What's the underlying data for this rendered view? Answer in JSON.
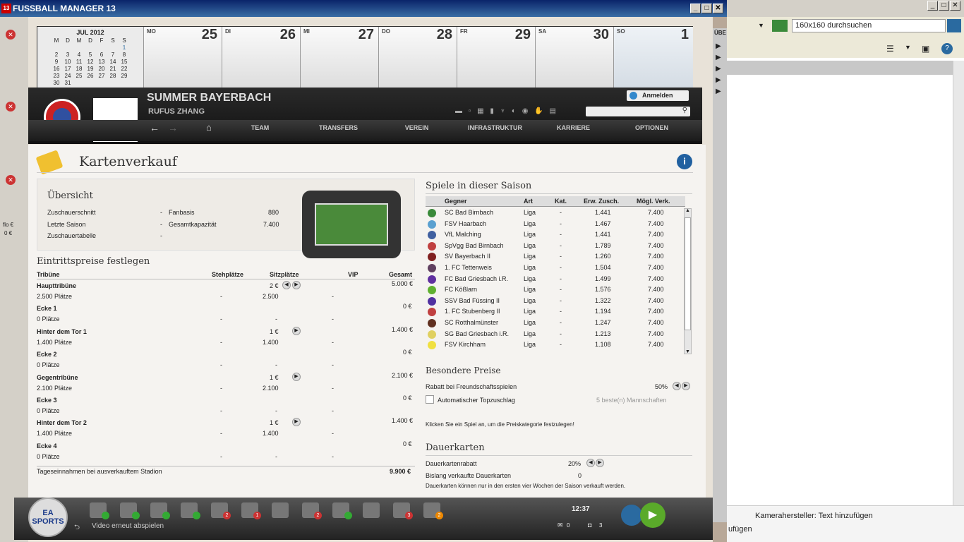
{
  "window": {
    "title": "FUSSBALL MANAGER 13",
    "logo": "13"
  },
  "calendar": {
    "month": "JUL 2012",
    "weekdays": [
      "M",
      "D",
      "M",
      "D",
      "F",
      "S",
      "S"
    ],
    "weeks": [
      [
        "",
        "",
        "",
        "",
        "",
        "",
        "1"
      ],
      [
        "2",
        "3",
        "4",
        "5",
        "6",
        "7",
        "8"
      ],
      [
        "9",
        "10",
        "11",
        "12",
        "13",
        "14",
        "15"
      ],
      [
        "16",
        "17",
        "18",
        "19",
        "20",
        "21",
        "22"
      ],
      [
        "23",
        "24",
        "25",
        "26",
        "27",
        "28",
        "29"
      ],
      [
        "30",
        "31",
        "",
        "",
        "",
        "",
        ""
      ]
    ],
    "days": [
      {
        "name": "MO",
        "num": "25"
      },
      {
        "name": "DI",
        "num": "26"
      },
      {
        "name": "MI",
        "num": "27"
      },
      {
        "name": "DO",
        "num": "28"
      },
      {
        "name": "FR",
        "num": "29"
      },
      {
        "name": "SA",
        "num": "30"
      },
      {
        "name": "SO",
        "num": "1"
      }
    ]
  },
  "club": {
    "name": "SUMMER BAYERBACH",
    "manager": "RUFUS ZHANG",
    "login_label": "Anmelden"
  },
  "nav": [
    "TEAM",
    "TRANSFERS",
    "VEREIN",
    "INFRASTRUKTUR",
    "KARRIERE",
    "OPTIONEN"
  ],
  "page": {
    "title": "Kartenverkauf"
  },
  "overview": {
    "title": "Übersicht",
    "left": [
      {
        "label": "Zuschauerschnitt",
        "value": "-"
      },
      {
        "label": "Letzte Saison",
        "value": "-"
      },
      {
        "label": "Zuschauertabelle",
        "value": "-"
      }
    ],
    "right": [
      {
        "label": "Fanbasis",
        "value": "880"
      },
      {
        "label": "Gesamtkapazität",
        "value": "7.400"
      }
    ]
  },
  "prices": {
    "title": "Eintrittspreise festlegen",
    "headers": [
      "Tribüne",
      "Stehplätze",
      "Sitzplätze",
      "VIP",
      "Gesamt"
    ],
    "rows": [
      {
        "name": "Haupttribüne",
        "places": "2.500 Plätze",
        "price": "2 €",
        "steh": "-",
        "sitz": "2.500",
        "vip": "-",
        "total": "5.000 €"
      },
      {
        "name": "Ecke 1",
        "places": "0 Plätze",
        "price": "",
        "steh": "-",
        "sitz": "-",
        "vip": "-",
        "total": "0 €"
      },
      {
        "name": "Hinter dem Tor 1",
        "places": "1.400 Plätze",
        "price": "1 €",
        "steh": "-",
        "sitz": "1.400",
        "vip": "-",
        "total": "1.400 €"
      },
      {
        "name": "Ecke 2",
        "places": "0 Plätze",
        "price": "",
        "steh": "-",
        "sitz": "-",
        "vip": "-",
        "total": "0 €"
      },
      {
        "name": "Gegentribüne",
        "places": "2.100 Plätze",
        "price": "1 €",
        "steh": "-",
        "sitz": "2.100",
        "vip": "-",
        "total": "2.100 €"
      },
      {
        "name": "Ecke 3",
        "places": "0 Plätze",
        "price": "",
        "steh": "-",
        "sitz": "-",
        "vip": "-",
        "total": "0 €"
      },
      {
        "name": "Hinter dem Tor 2",
        "places": "1.400 Plätze",
        "price": "1 €",
        "steh": "-",
        "sitz": "1.400",
        "vip": "-",
        "total": "1.400 €"
      },
      {
        "name": "Ecke 4",
        "places": "0 Plätze",
        "price": "",
        "steh": "-",
        "sitz": "-",
        "vip": "-",
        "total": "0 €"
      }
    ],
    "footer_label": "Tageseinnahmen bei ausverkauftem Stadion",
    "footer_value": "9.900 €"
  },
  "games": {
    "title": "Spiele in dieser Saison",
    "headers": [
      "Gegner",
      "Art",
      "Kat.",
      "Erw. Zusch.",
      "Mögl. Verk."
    ],
    "rows": [
      {
        "team": "SC Bad Birnbach",
        "art": "Liga",
        "kat": "-",
        "erw": "1.441",
        "moegl": "7.400",
        "color": "#3a8a3a"
      },
      {
        "team": "FSV Haarbach",
        "art": "Liga",
        "kat": "-",
        "erw": "1.467",
        "moegl": "7.400",
        "color": "#5aa0d0"
      },
      {
        "team": "VfL Malching",
        "art": "Liga",
        "kat": "-",
        "erw": "1.441",
        "moegl": "7.400",
        "color": "#4060a0"
      },
      {
        "team": "SpVgg Bad Birnbach",
        "art": "Liga",
        "kat": "-",
        "erw": "1.789",
        "moegl": "7.400",
        "color": "#c04040"
      },
      {
        "team": "SV Bayerbach II",
        "art": "Liga",
        "kat": "-",
        "erw": "1.260",
        "moegl": "7.400",
        "color": "#802020"
      },
      {
        "team": "1. FC Tettenweis",
        "art": "Liga",
        "kat": "-",
        "erw": "1.504",
        "moegl": "7.400",
        "color": "#604060"
      },
      {
        "team": "FC Bad Griesbach i.R.",
        "art": "Liga",
        "kat": "-",
        "erw": "1.499",
        "moegl": "7.400",
        "color": "#6030a0"
      },
      {
        "team": "FC Kößlarn",
        "art": "Liga",
        "kat": "-",
        "erw": "1.576",
        "moegl": "7.400",
        "color": "#60b030"
      },
      {
        "team": "SSV Bad Füssing II",
        "art": "Liga",
        "kat": "-",
        "erw": "1.322",
        "moegl": "7.400",
        "color": "#5030a0"
      },
      {
        "team": "1. FC Stubenberg II",
        "art": "Liga",
        "kat": "-",
        "erw": "1.194",
        "moegl": "7.400",
        "color": "#c04040"
      },
      {
        "team": "SC Rotthalmünster",
        "art": "Liga",
        "kat": "-",
        "erw": "1.247",
        "moegl": "7.400",
        "color": "#603020"
      },
      {
        "team": "SG Bad Griesbach i.R.",
        "art": "Liga",
        "kat": "-",
        "erw": "1.213",
        "moegl": "7.400",
        "color": "#e0d060"
      },
      {
        "team": "FSV Kirchham",
        "art": "Liga",
        "kat": "-",
        "erw": "1.108",
        "moegl": "7.400",
        "color": "#f0e040"
      }
    ]
  },
  "special": {
    "title": "Besondere Preise",
    "rabatt_label": "Rabatt bei Freundschaftsspielen",
    "rabatt_value": "50%",
    "auto_label": "Automatischer Topzuschlag",
    "auto_hint": "5 beste(n) Mannschaften",
    "info": "Klicken Sie ein Spiel an, um die Preiskategorie festzulegen!"
  },
  "season": {
    "title": "Dauerkarten",
    "rabatt_label": "Dauerkartenrabatt",
    "rabatt_value": "20%",
    "sold_label": "Bislang verkaufte Dauerkarten",
    "sold_value": "0",
    "note": "Dauerkarten können nur in den ersten vier Wochen der Saison verkauft werden."
  },
  "bottom": {
    "video_label": "Video erneut abspielen",
    "time": "12:37",
    "mail": "0",
    "msg": "3",
    "ea_label": "EA SPORTS",
    "badges": [
      {
        "value": "",
        "color": "#3a3"
      },
      {
        "value": "",
        "color": "#3a3"
      },
      {
        "value": "",
        "color": "#3a3"
      },
      {
        "value": "",
        "color": "#3a3"
      },
      {
        "value": "2",
        "color": "#c33"
      },
      {
        "value": "1",
        "color": "#c33"
      },
      {
        "value": "2",
        "color": "#c33"
      },
      {
        "value": "",
        "color": "#3a3"
      },
      {
        "value": "3",
        "color": "#c33"
      },
      {
        "value": "2",
        "color": "#e80"
      }
    ]
  },
  "right": {
    "search_placeholder": "160x160 durchsuchen",
    "status": "Kamerahersteller: Text hinzufügen",
    "status2": "ufügen",
    "tab_label": "ÜBE"
  },
  "left": {
    "val1": "flo €",
    "val2": "0 €"
  }
}
